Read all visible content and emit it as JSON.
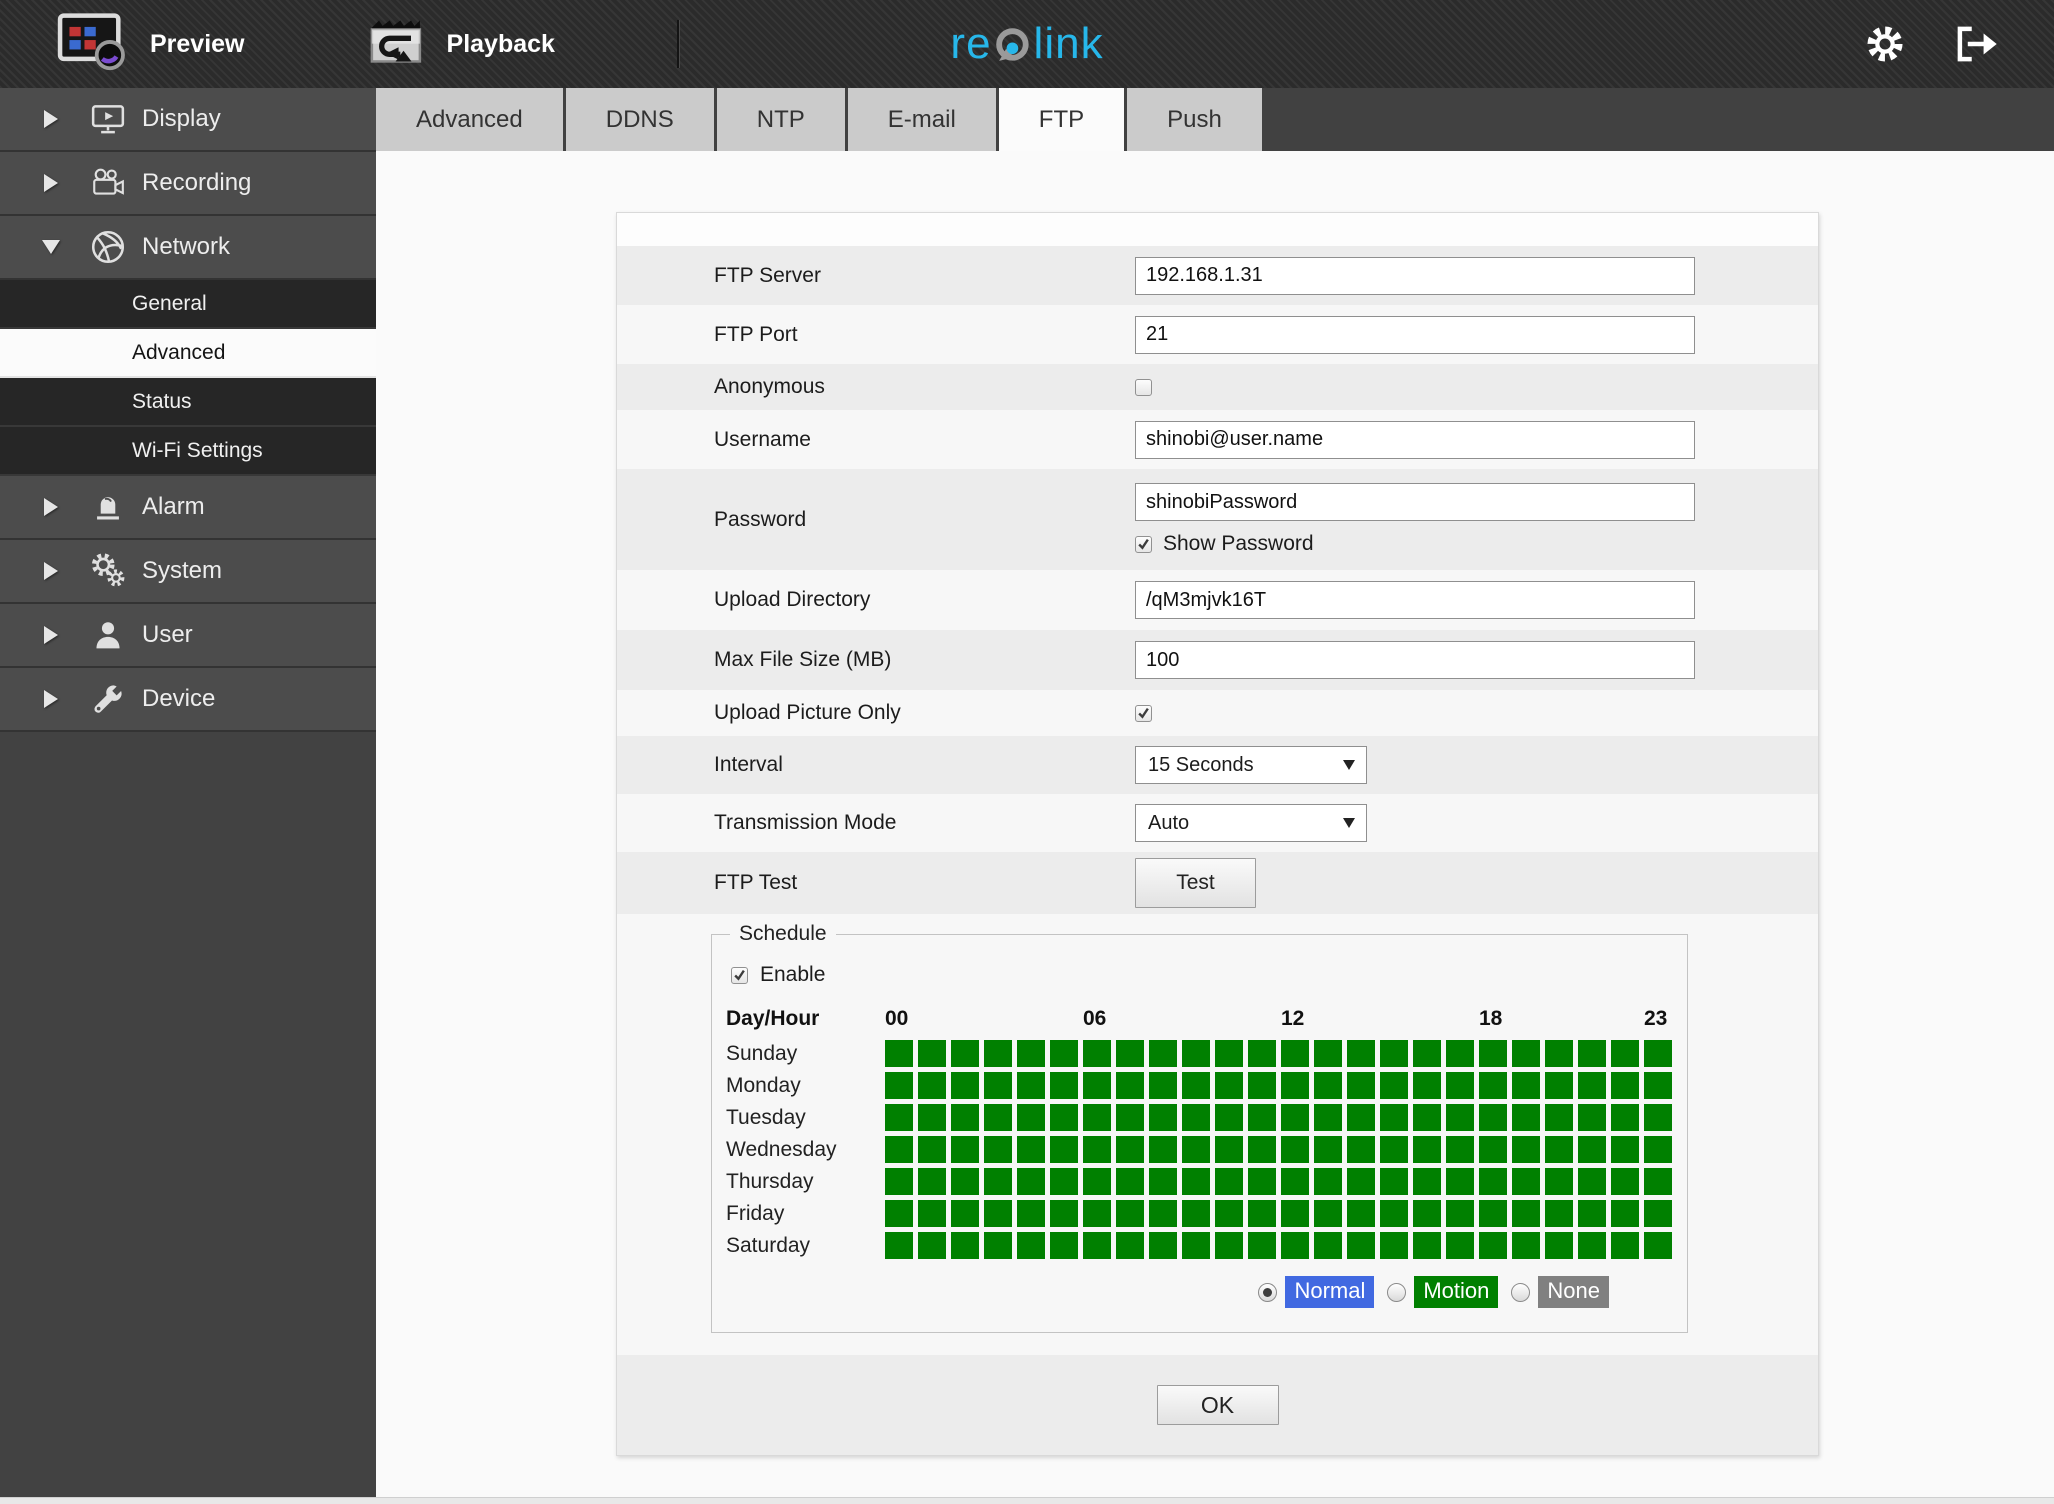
{
  "top_bar": {
    "preview_label": "Preview",
    "playback_label": "Playback",
    "logo": {
      "re": "re",
      "o": "o",
      "link": "link"
    },
    "brand_color": "#27b7ea"
  },
  "sidebar": {
    "items": [
      {
        "label": "Display",
        "icon": "display-icon",
        "state": "collapsed"
      },
      {
        "label": "Recording",
        "icon": "recording-icon",
        "state": "collapsed"
      },
      {
        "label": "Network",
        "icon": "network-icon",
        "state": "expanded",
        "children": [
          {
            "label": "General",
            "selected": false
          },
          {
            "label": "Advanced",
            "selected": true
          },
          {
            "label": "Status",
            "selected": false
          },
          {
            "label": "Wi-Fi Settings",
            "selected": false
          }
        ]
      },
      {
        "label": "Alarm",
        "icon": "alarm-icon",
        "state": "collapsed"
      },
      {
        "label": "System",
        "icon": "system-icon",
        "state": "collapsed"
      },
      {
        "label": "User",
        "icon": "user-icon",
        "state": "collapsed"
      },
      {
        "label": "Device",
        "icon": "device-icon",
        "state": "collapsed"
      }
    ]
  },
  "tabs": [
    {
      "label": "Advanced",
      "active": false
    },
    {
      "label": "DDNS",
      "active": false
    },
    {
      "label": "NTP",
      "active": false
    },
    {
      "label": "E-mail",
      "active": false
    },
    {
      "label": "FTP",
      "active": true
    },
    {
      "label": "Push",
      "active": false
    }
  ],
  "form": {
    "ftp_server": {
      "label": "FTP Server",
      "value": "192.168.1.31"
    },
    "ftp_port": {
      "label": "FTP Port",
      "value": "21"
    },
    "anonymous": {
      "label": "Anonymous",
      "checked": false
    },
    "username": {
      "label": "Username",
      "value": "shinobi@user.name"
    },
    "password": {
      "label": "Password",
      "value": "shinobiPassword",
      "show_password_label": "Show Password",
      "show_password_checked": true
    },
    "upload_directory": {
      "label": "Upload Directory",
      "value": "/qM3mjvk16T"
    },
    "max_file_size": {
      "label": "Max File Size (MB)",
      "value": "100"
    },
    "upload_picture_only": {
      "label": "Upload Picture Only",
      "checked": true
    },
    "interval": {
      "label": "Interval",
      "value": "15 Seconds"
    },
    "transmission_mode": {
      "label": "Transmission Mode",
      "value": "Auto"
    },
    "ftp_test": {
      "label": "FTP Test",
      "button_label": "Test"
    }
  },
  "schedule": {
    "legend": "Schedule",
    "enable_label": "Enable",
    "enable_checked": true,
    "grid_header": "Day/Hour",
    "hour_labels": [
      "00",
      "06",
      "12",
      "18",
      "23"
    ],
    "days": [
      "Sunday",
      "Monday",
      "Tuesday",
      "Wednesday",
      "Thursday",
      "Friday",
      "Saturday"
    ],
    "hours_per_day": 24,
    "all_cells_state": "on",
    "cell_color": "#008000",
    "modes": [
      {
        "label": "Normal",
        "color": "#4169e1",
        "selected": true
      },
      {
        "label": "Motion",
        "color": "#008000",
        "selected": false
      },
      {
        "label": "None",
        "color": "#808080",
        "selected": false
      }
    ]
  },
  "ok_button_label": "OK"
}
